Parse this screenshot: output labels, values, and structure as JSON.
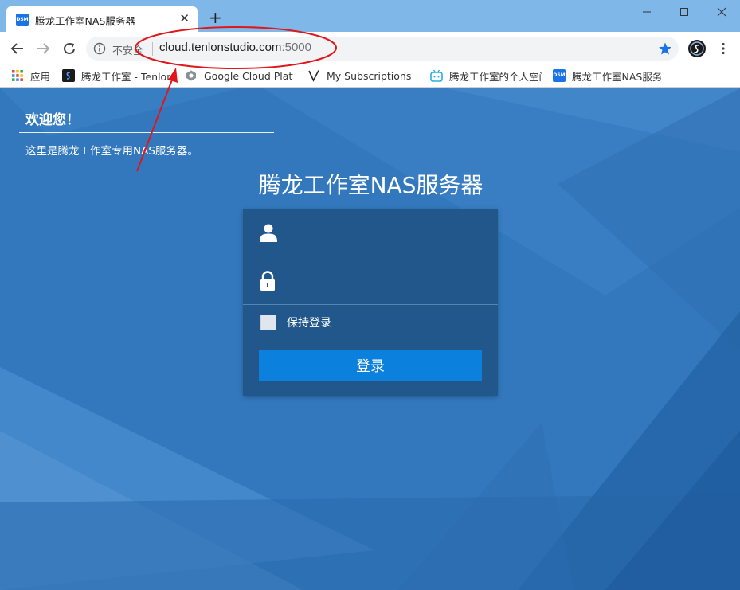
{
  "browser": {
    "tab_title": "腾龙工作室NAS服务器",
    "tab_favicon_text": "DSM",
    "new_tab_label": "+",
    "close_tab_label": "✕",
    "security_label": "不安全",
    "url_host": "cloud.tenlonstudio.com",
    "url_port": ":5000"
  },
  "bookmarks": [
    {
      "label": "应用",
      "icon": "apps-grid-icon"
    },
    {
      "label": "腾龙工作室 - Tenlon",
      "icon": "tenlon-logo-icon"
    },
    {
      "label": "Google Cloud Platfo",
      "icon": "google-cloud-icon"
    },
    {
      "label": "My Subscriptions -",
      "icon": "v-logo-icon"
    },
    {
      "label": "腾龙工作室的个人空间",
      "icon": "bilibili-icon"
    },
    {
      "label": "腾龙工作室NAS服务器",
      "icon": "dsm-icon"
    }
  ],
  "welcome": {
    "title": "欢迎您！",
    "text": "这里是腾龙工作室专用NAS服务器。"
  },
  "login": {
    "title": "腾龙工作室NAS服务器",
    "username_value": "",
    "password_value": "",
    "remember_label": "保持登录",
    "remember_checked": false,
    "submit_label": "登录"
  },
  "colors": {
    "page_background": "#3378bd",
    "panel_background": "#22578c",
    "login_button": "#0b80dd",
    "annotation": "#e0161b"
  }
}
